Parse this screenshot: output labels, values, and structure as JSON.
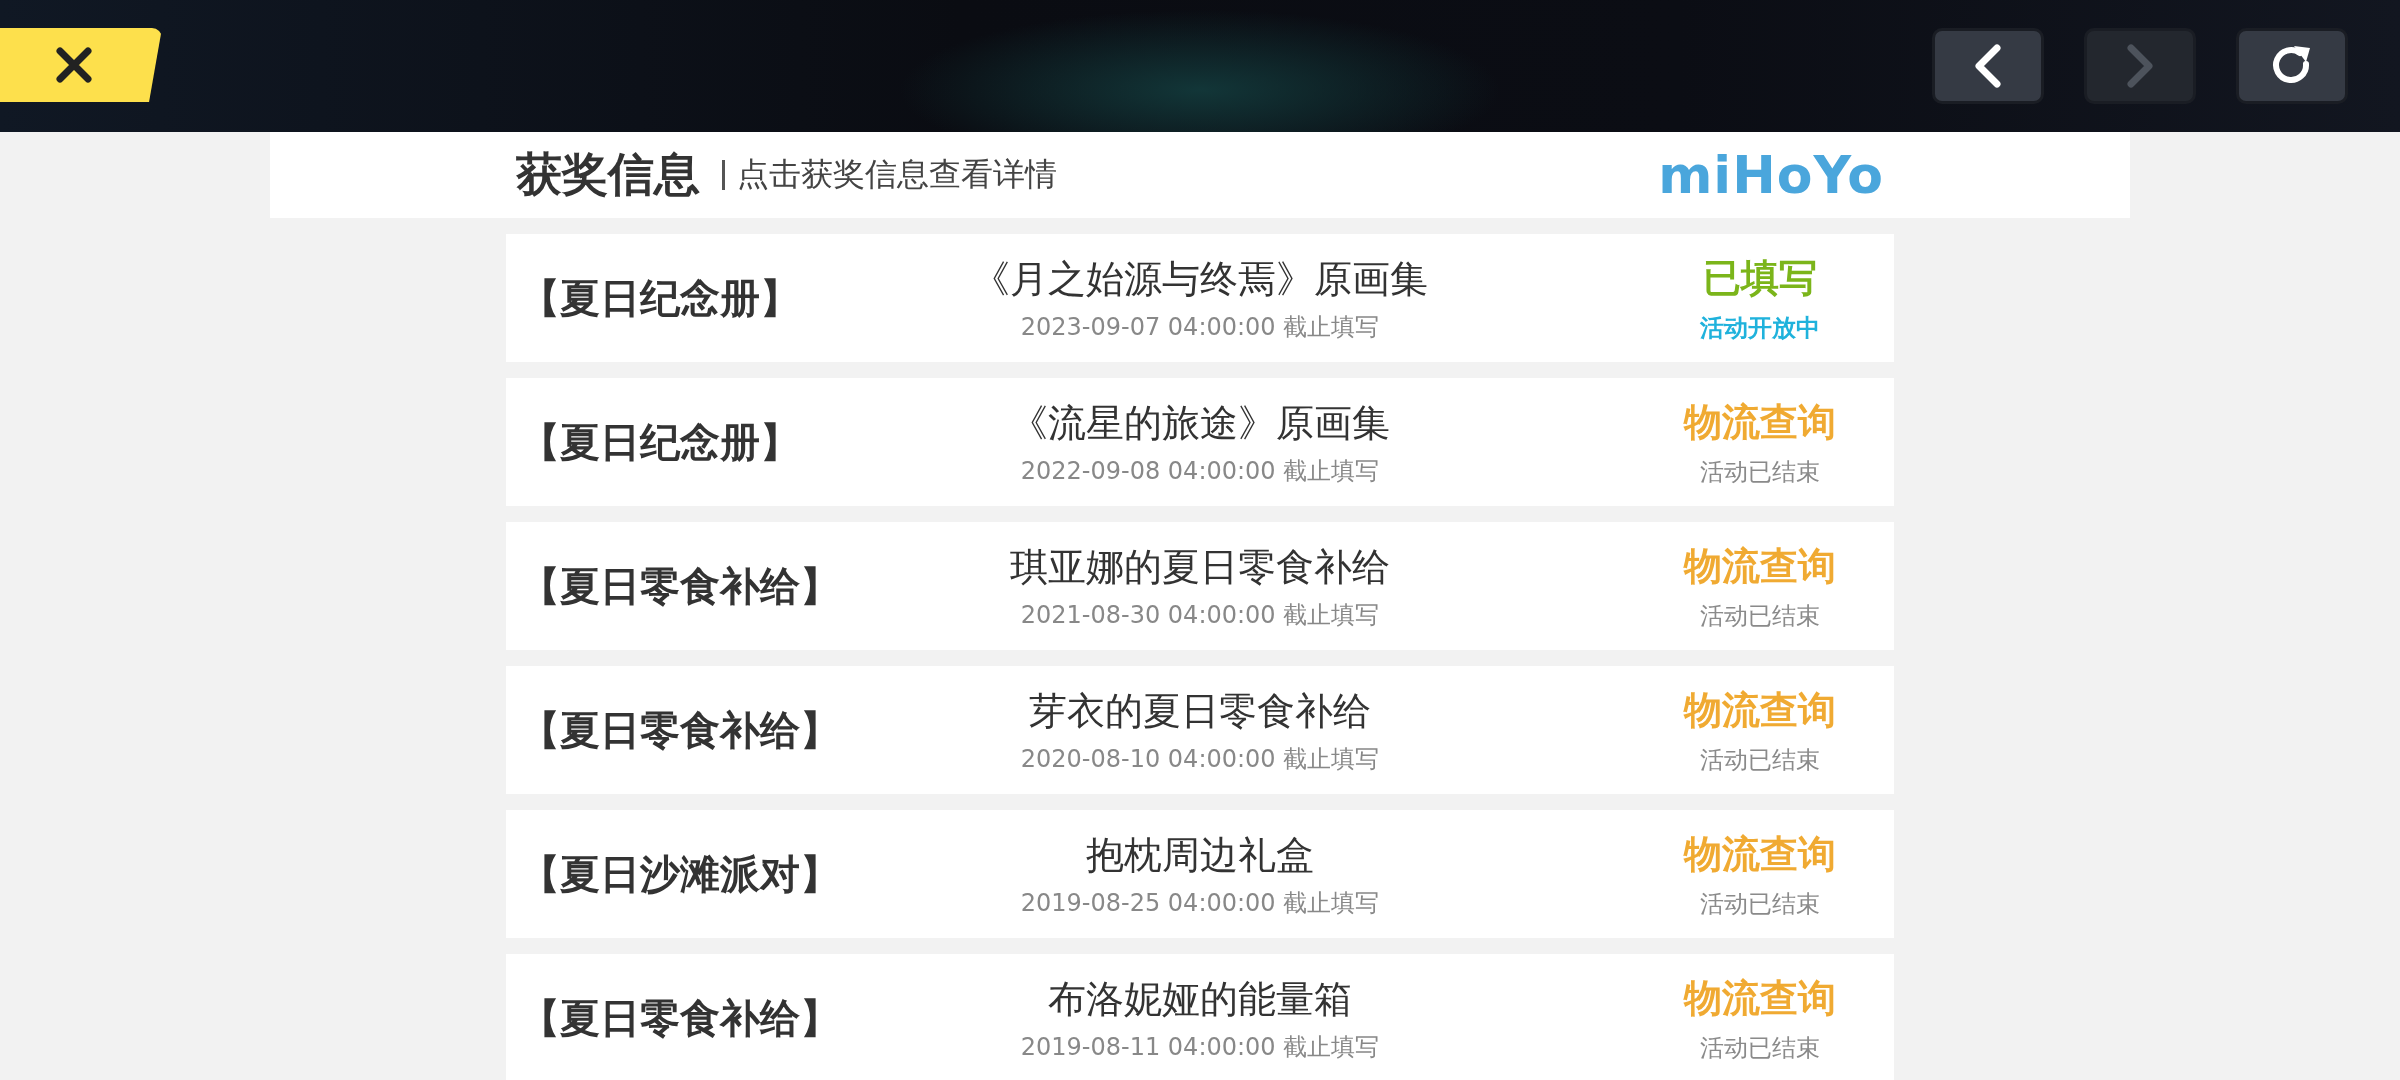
{
  "top_bar": {
    "nav_buttons": [
      {
        "kind": "back",
        "disabled": false
      },
      {
        "kind": "forward",
        "disabled": true
      },
      {
        "kind": "refresh",
        "disabled": false
      }
    ]
  },
  "header": {
    "title": "获奖信息",
    "hint": "点击获奖信息查看详情",
    "logo": "miHoYo"
  },
  "prizes": [
    {
      "category": "【夏日纪念册】",
      "title": "《月之始源与终焉》原画集",
      "deadline": "2023-09-07 04:00:00 截止填写",
      "kind": "filled",
      "status": "已填写",
      "event_state": "活动开放中"
    },
    {
      "category": "【夏日纪念册】",
      "title": "《流星的旅途》原画集",
      "deadline": "2022-09-08 04:00:00 截止填写",
      "kind": "logistics",
      "status": "物流查询",
      "event_state": "活动已结束"
    },
    {
      "category": "【夏日零食补给】",
      "title": "琪亚娜的夏日零食补给",
      "deadline": "2021-08-30 04:00:00 截止填写",
      "kind": "logistics",
      "status": "物流查询",
      "event_state": "活动已结束"
    },
    {
      "category": "【夏日零食补给】",
      "title": "芽衣的夏日零食补给",
      "deadline": "2020-08-10 04:00:00 截止填写",
      "kind": "logistics",
      "status": "物流查询",
      "event_state": "活动已结束"
    },
    {
      "category": "【夏日沙滩派对】",
      "title": "抱枕周边礼盒",
      "deadline": "2019-08-25 04:00:00 截止填写",
      "kind": "logistics",
      "status": "物流查询",
      "event_state": "活动已结束"
    },
    {
      "category": "【夏日零食补给】",
      "title": "布洛妮娅的能量箱",
      "deadline": "2019-08-11 04:00:00 截止填写",
      "kind": "logistics",
      "status": "物流查询",
      "event_state": "活动已结束"
    }
  ]
}
